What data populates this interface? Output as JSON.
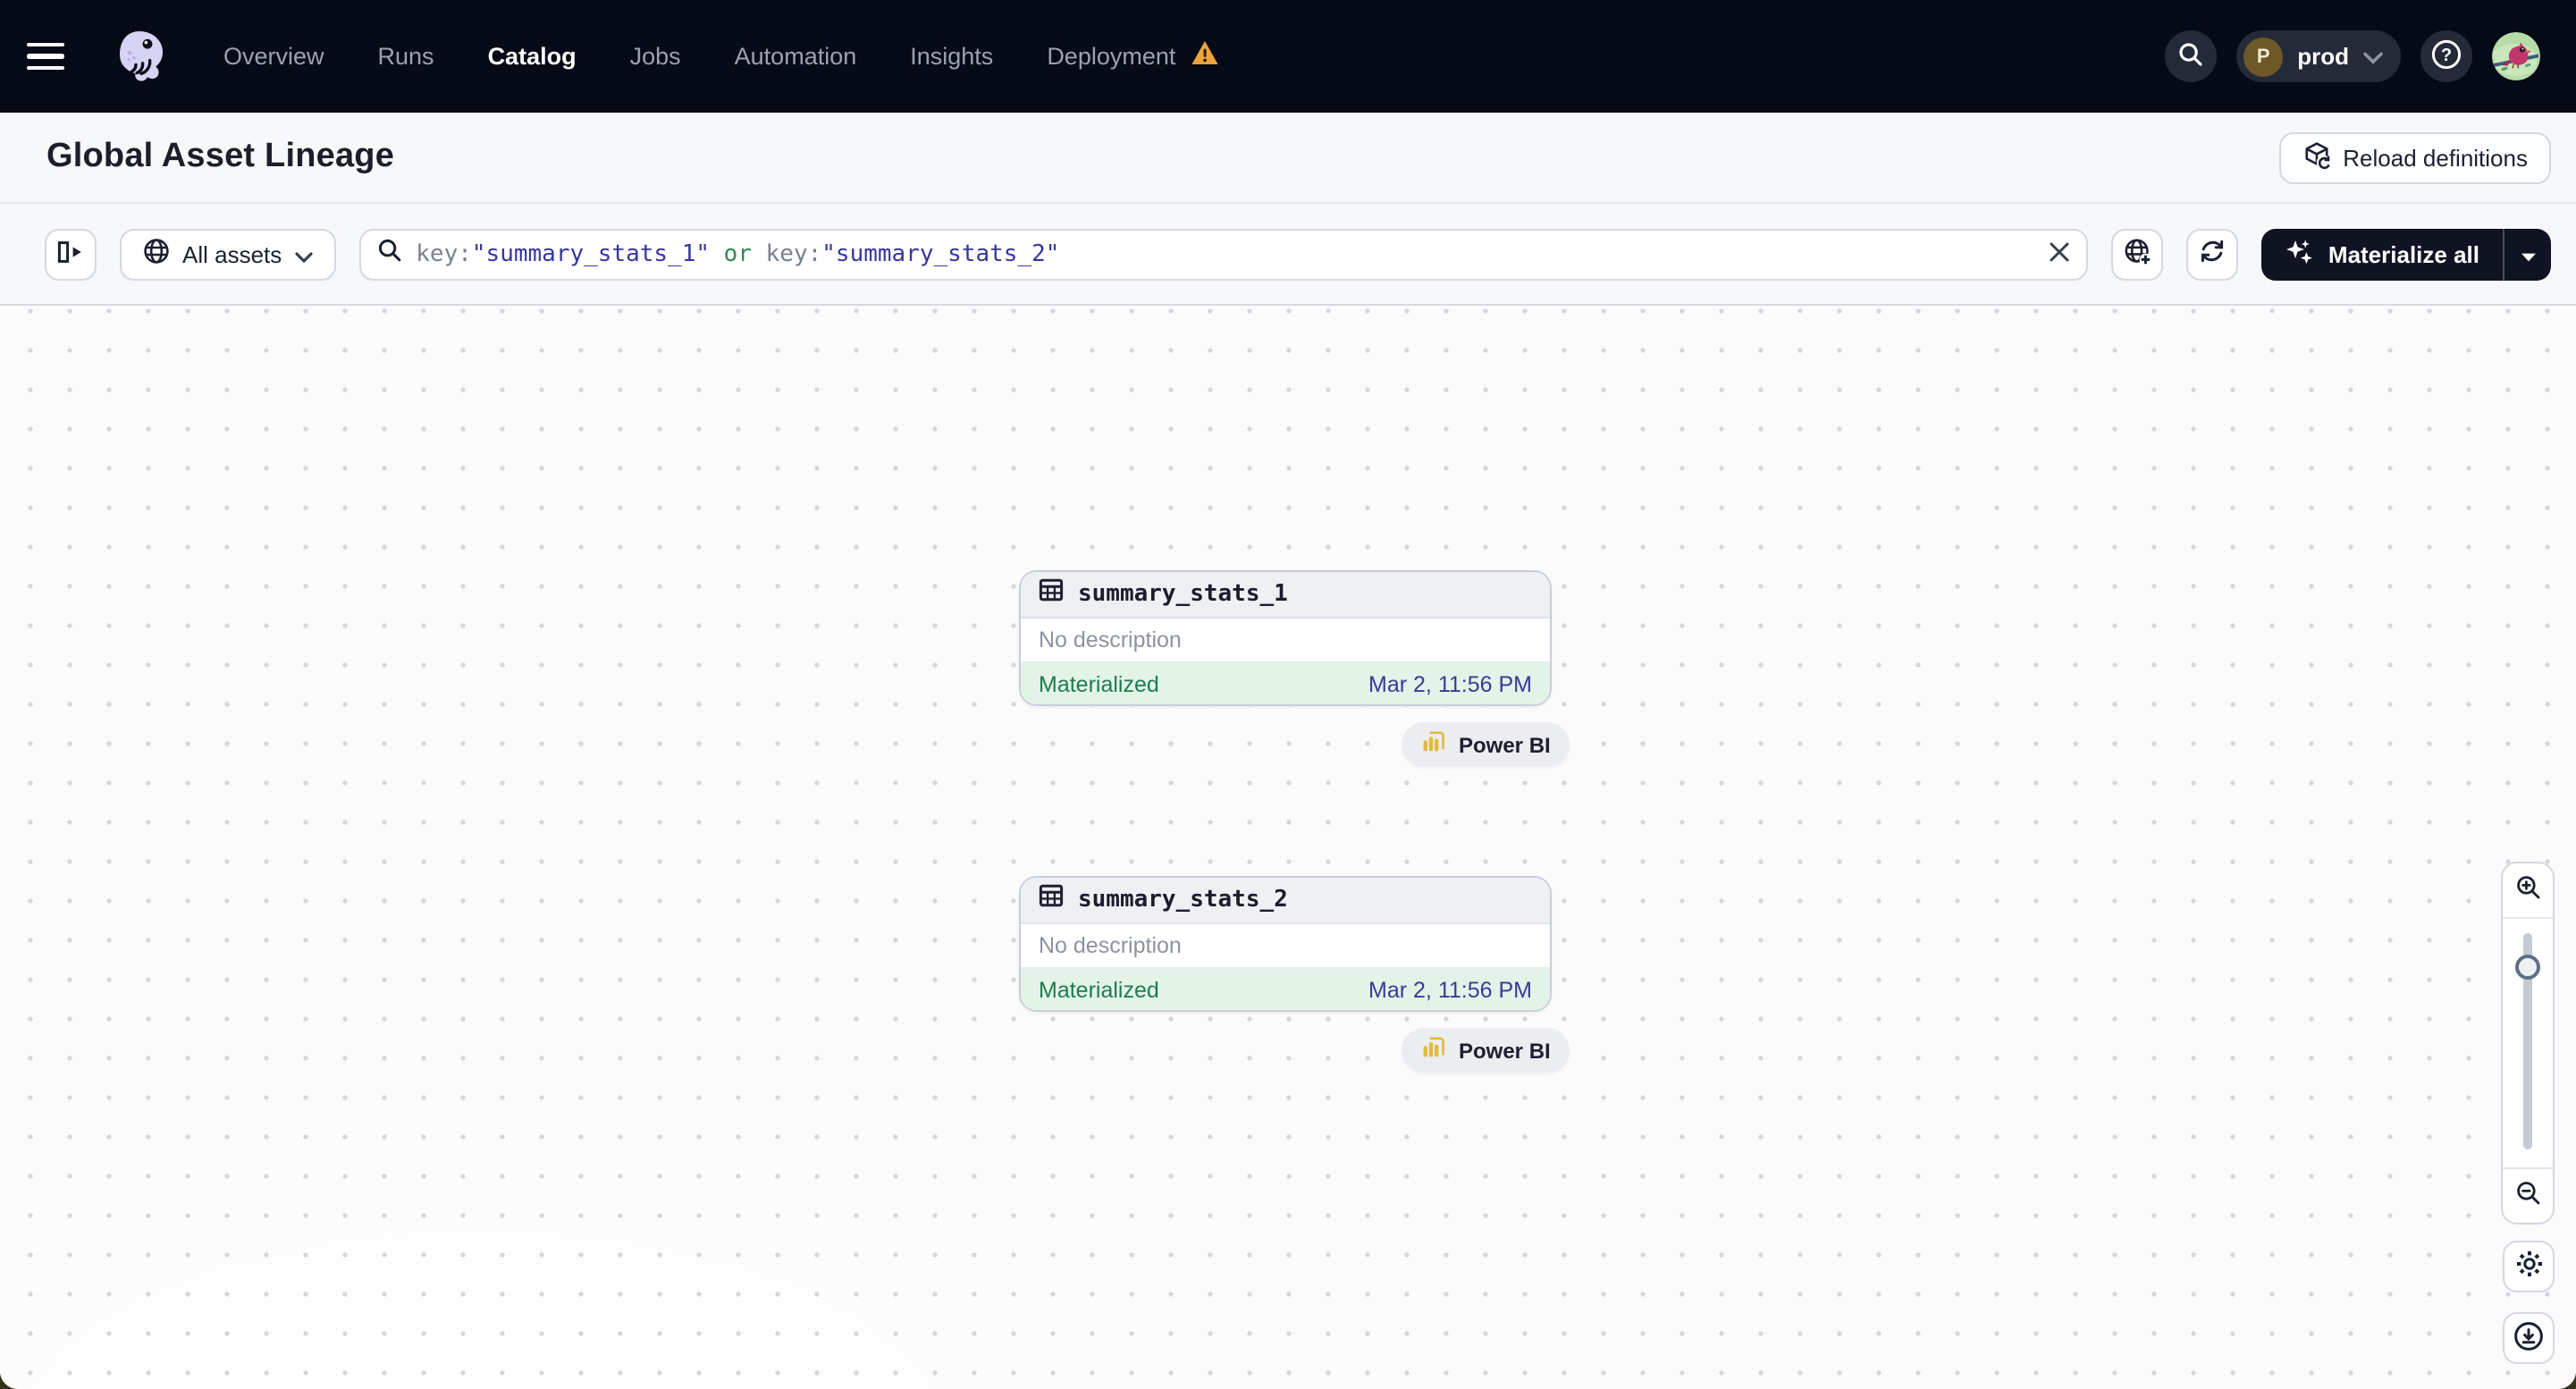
{
  "topnav": {
    "items": [
      {
        "label": "Overview",
        "active": false
      },
      {
        "label": "Runs",
        "active": false
      },
      {
        "label": "Catalog",
        "active": true
      },
      {
        "label": "Jobs",
        "active": false
      },
      {
        "label": "Automation",
        "active": false
      },
      {
        "label": "Insights",
        "active": false
      },
      {
        "label": "Deployment",
        "active": false,
        "warning": true
      }
    ],
    "deployment": {
      "initial": "P",
      "name": "prod"
    }
  },
  "header": {
    "title": "Global Asset Lineage",
    "reload_label": "Reload definitions"
  },
  "toolbar": {
    "asset_filter_label": "All assets",
    "search": {
      "key1": "key:",
      "value1": "\"summary_stats_1\"",
      "operator": " or ",
      "key2": "key:",
      "value2": "\"summary_stats_2\""
    },
    "materialize_label": "Materialize all"
  },
  "graph": {
    "nodes": [
      {
        "name": "summary_stats_1",
        "description": "No description",
        "status": "Materialized",
        "timestamp": "Mar 2, 11:56 PM",
        "tag": "Power BI"
      },
      {
        "name": "summary_stats_2",
        "description": "No description",
        "status": "Materialized",
        "timestamp": "Mar 2, 11:56 PM",
        "tag": "Power BI"
      }
    ]
  },
  "colors": {
    "nav_bg": "#060a16",
    "status_green": "#1d7d4d",
    "status_row_bg": "#e3f3e8",
    "timestamp_blue": "#3a3a94",
    "query_string_blue": "#37379b",
    "query_operator_green": "#2f8a57",
    "warning_orange": "#efa33c",
    "powerbi_yellow": "#e4b93f",
    "materialize_bg": "#0f1322"
  },
  "icons": [
    "hamburger-icon",
    "dagster-logo",
    "warning-icon",
    "search-icon",
    "chevron-down-icon",
    "help-icon",
    "avatar",
    "reload-cube-icon",
    "panel-toggle-icon",
    "globe-icon",
    "magnifier-icon",
    "clear-icon",
    "globe-add-icon",
    "refresh-icon",
    "sparkles-icon",
    "caret-down-icon",
    "table-icon",
    "powerbi-icon",
    "zoom-in-icon",
    "zoom-out-icon",
    "gear-icon",
    "download-icon"
  ]
}
